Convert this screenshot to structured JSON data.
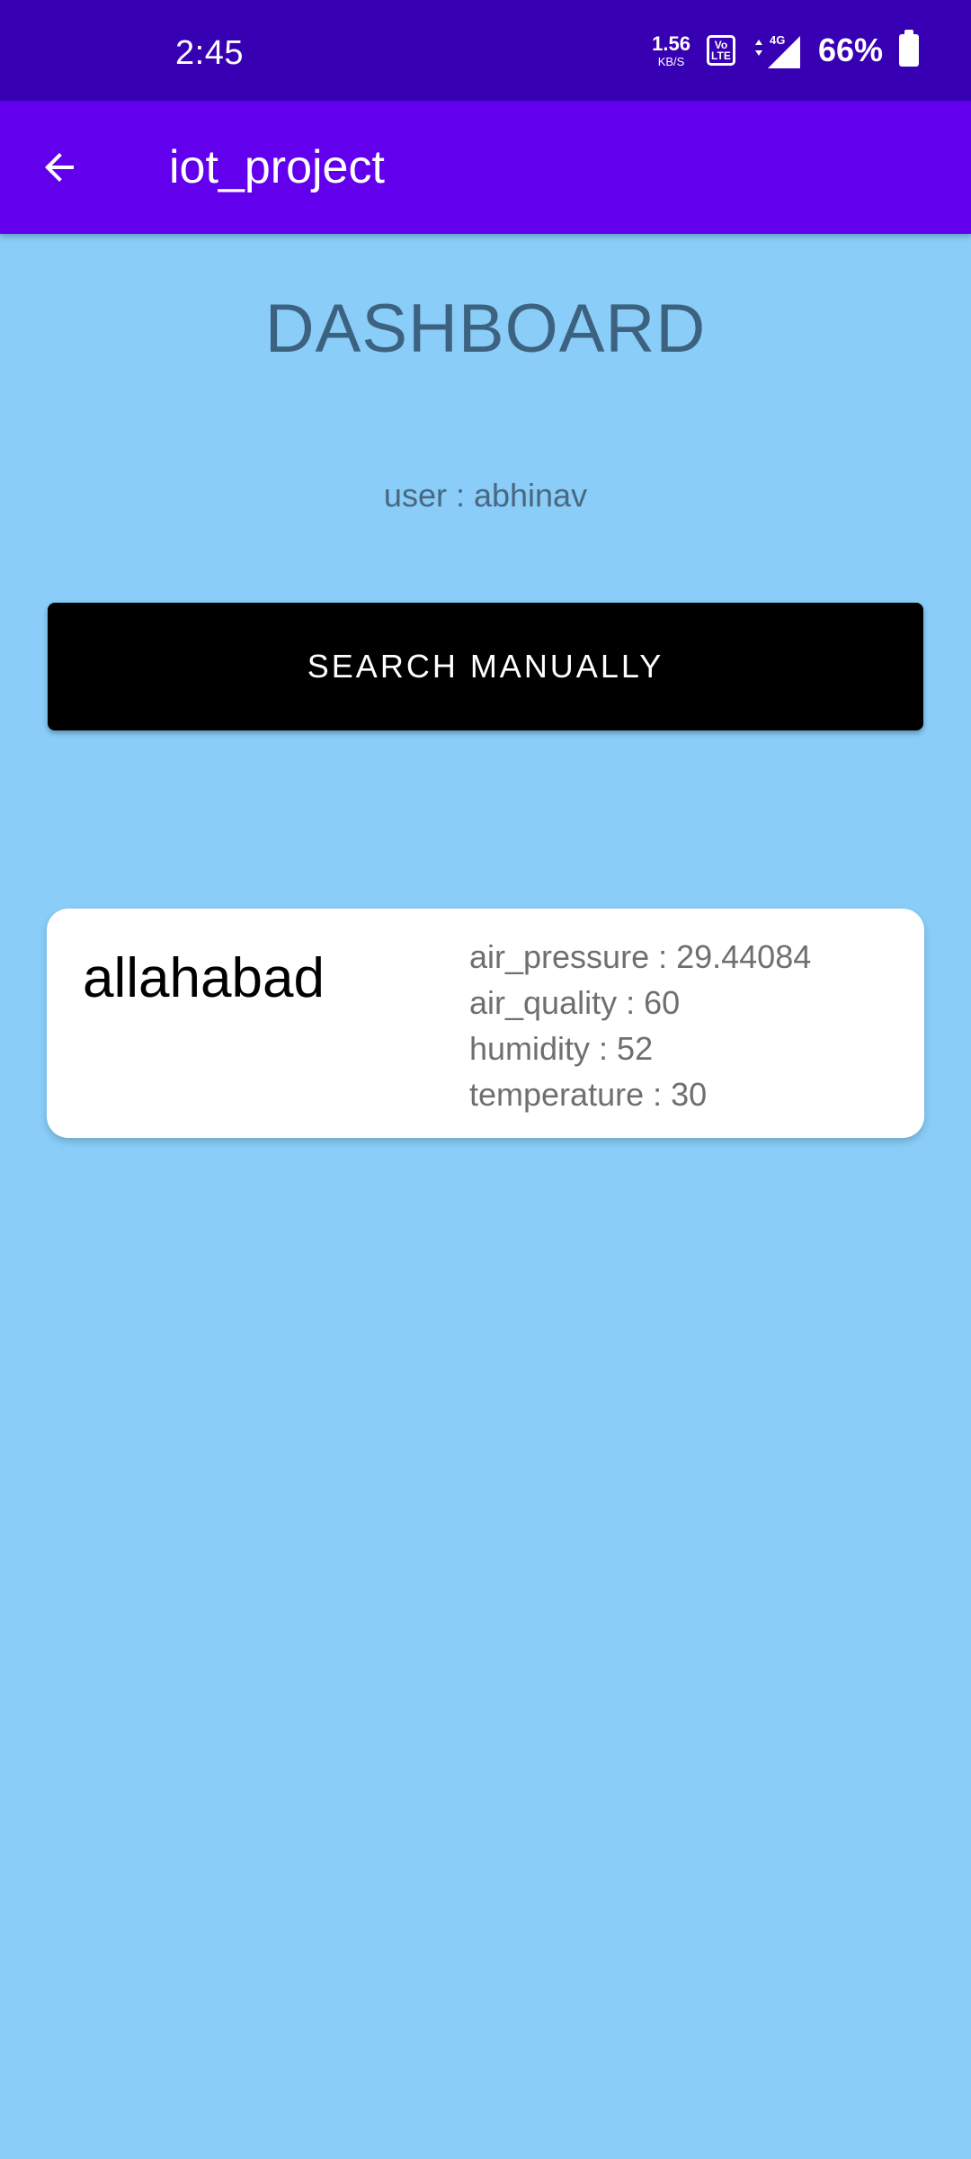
{
  "status_bar": {
    "time": "2:45",
    "net_speed_value": "1.56",
    "net_speed_unit": "KB/S",
    "volte_top": "Vo",
    "volte_bottom": "LTE",
    "network": "4G",
    "battery_percent": "66%"
  },
  "app_bar": {
    "title": "iot_project",
    "back_icon": "arrow-back-icon"
  },
  "dashboard": {
    "title": "DASHBOARD",
    "user_label": "user : ",
    "user_name": "abhinav",
    "search_button_label": "SEARCH MANUALLY"
  },
  "cards": [
    {
      "city": "allahabad",
      "air_pressure": "air_pressure : 29.44084",
      "air_quality": "air_quality : 60",
      "humidity": "humidity : 52",
      "temperature": "temperature : 30"
    }
  ],
  "colors": {
    "status_bar": "#3700b3",
    "app_bar": "#6200ee",
    "background": "#89cdf8",
    "button": "#000000"
  }
}
